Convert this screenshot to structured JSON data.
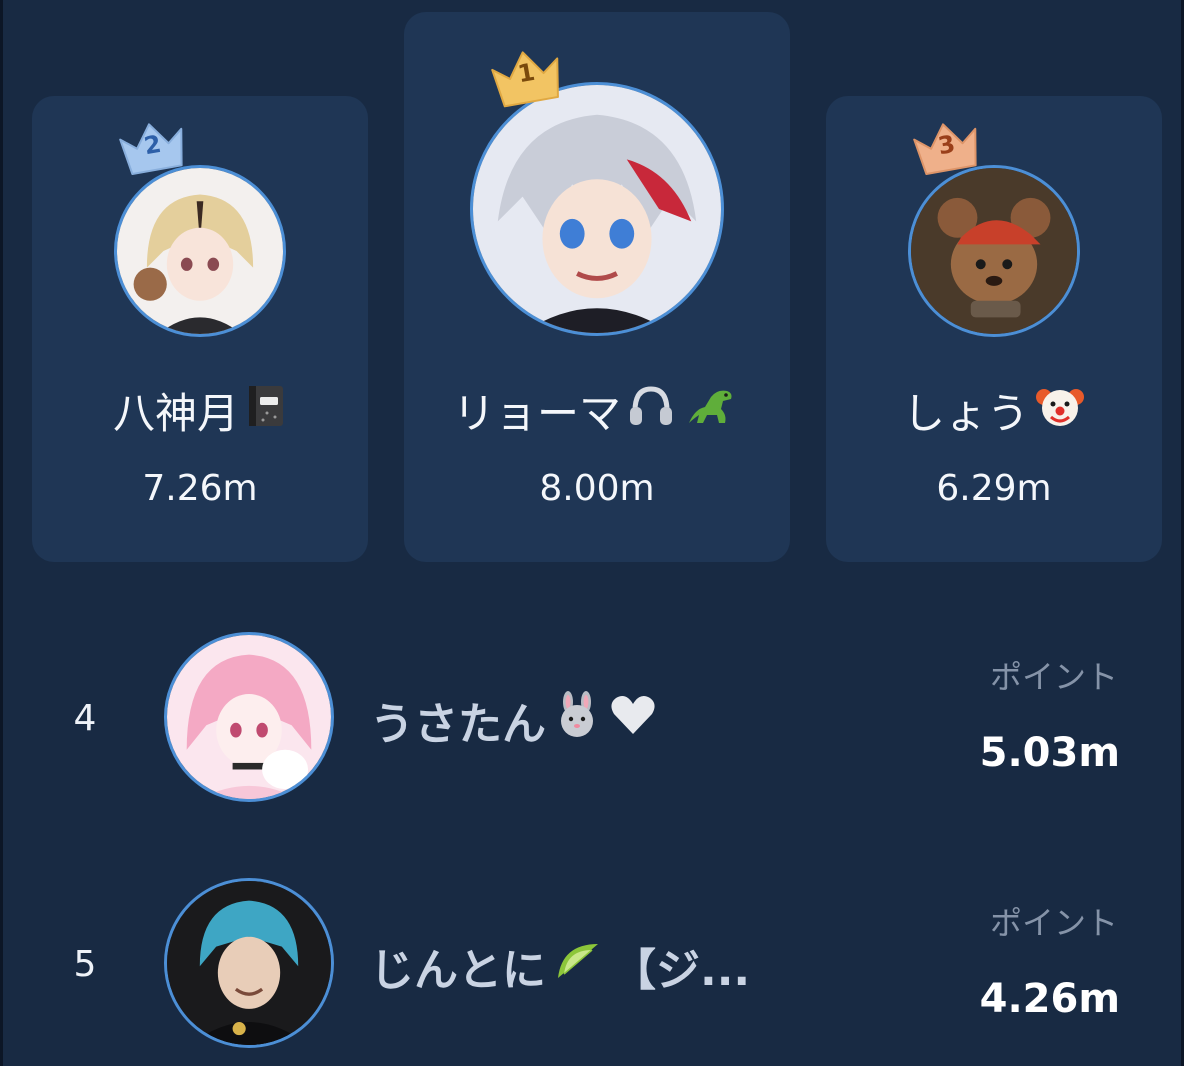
{
  "podium": [
    {
      "rank": "1",
      "name": "リョーマ",
      "score": "8.00m",
      "crown_color": "#f2c463",
      "crown_text_color": "#7a4a0c",
      "emojis": [
        "headphones-icon",
        "dinosaur-icon"
      ]
    },
    {
      "rank": "2",
      "name": "八神月",
      "score": "7.26m",
      "crown_color": "#a6c7ee",
      "crown_text_color": "#2d5fa8",
      "emojis": [
        "notebook-icon"
      ]
    },
    {
      "rank": "3",
      "name": "しょう",
      "score": "6.29m",
      "crown_color": "#efb08a",
      "crown_text_color": "#9a3f1a",
      "emojis": [
        "clown-face-icon"
      ]
    }
  ],
  "list": [
    {
      "rank": "4",
      "name": "うさたん",
      "points_label": "ポイント",
      "points": "5.03m",
      "emojis": [
        "rabbit-face-icon",
        "white-heart-icon"
      ]
    },
    {
      "rank": "5",
      "name": "じんとに",
      "name_suffix": "【ジ...",
      "points_label": "ポイント",
      "points": "4.26m",
      "emojis": [
        "lime-icon"
      ]
    }
  ],
  "colors": {
    "background": "#182a43",
    "card": "#1f3655",
    "avatar_border": "#4c8fd6",
    "muted_text": "#8593a8"
  }
}
